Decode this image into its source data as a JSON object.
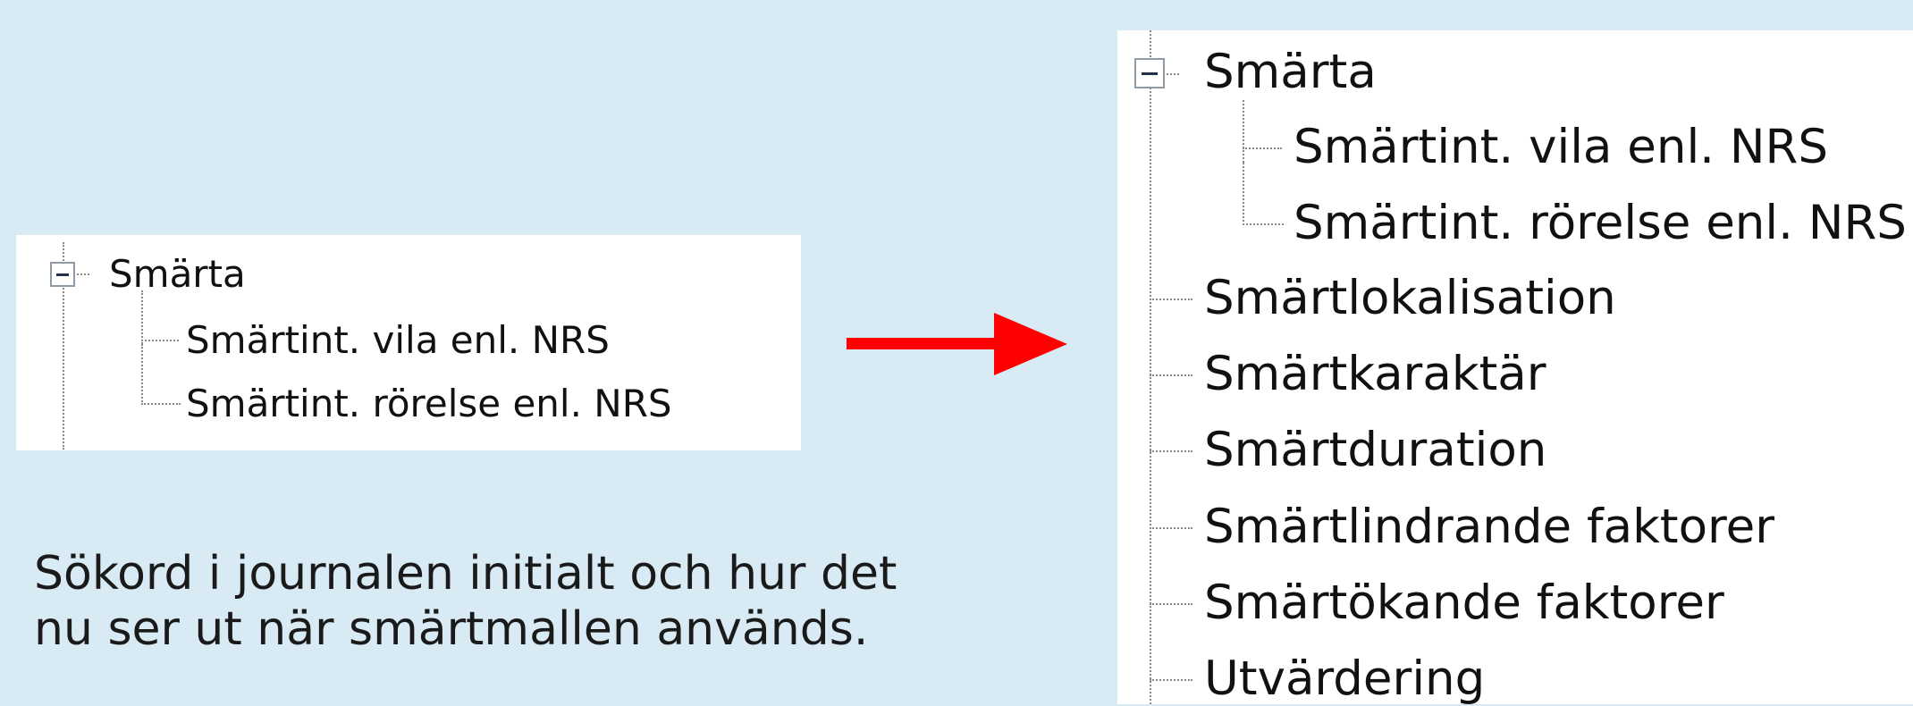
{
  "left_tree": {
    "root_label": "Smärta",
    "children": [
      "Smärtint. vila enl. NRS",
      "Smärtint. rörelse enl. NRS"
    ]
  },
  "right_tree": {
    "root_label": "Smärta",
    "root_children": [
      "Smärtint. vila enl. NRS",
      "Smärtint. rörelse enl. NRS"
    ],
    "siblings": [
      "Smärtlokalisation",
      "Smärtkaraktär",
      "Smärtduration",
      "Smärtlindrande faktorer",
      "Smärtökande faktorer",
      "Utvärdering"
    ]
  },
  "caption": {
    "line1": "Sökord i journalen  initialt och hur det",
    "line2": "nu ser ut när smärtmallen används."
  },
  "colors": {
    "background": "#d8eaf4",
    "arrow": "#ff0000",
    "panel": "#ffffff"
  },
  "icons": {
    "collapse": "minus-box-icon",
    "arrow": "arrow-right-icon"
  }
}
